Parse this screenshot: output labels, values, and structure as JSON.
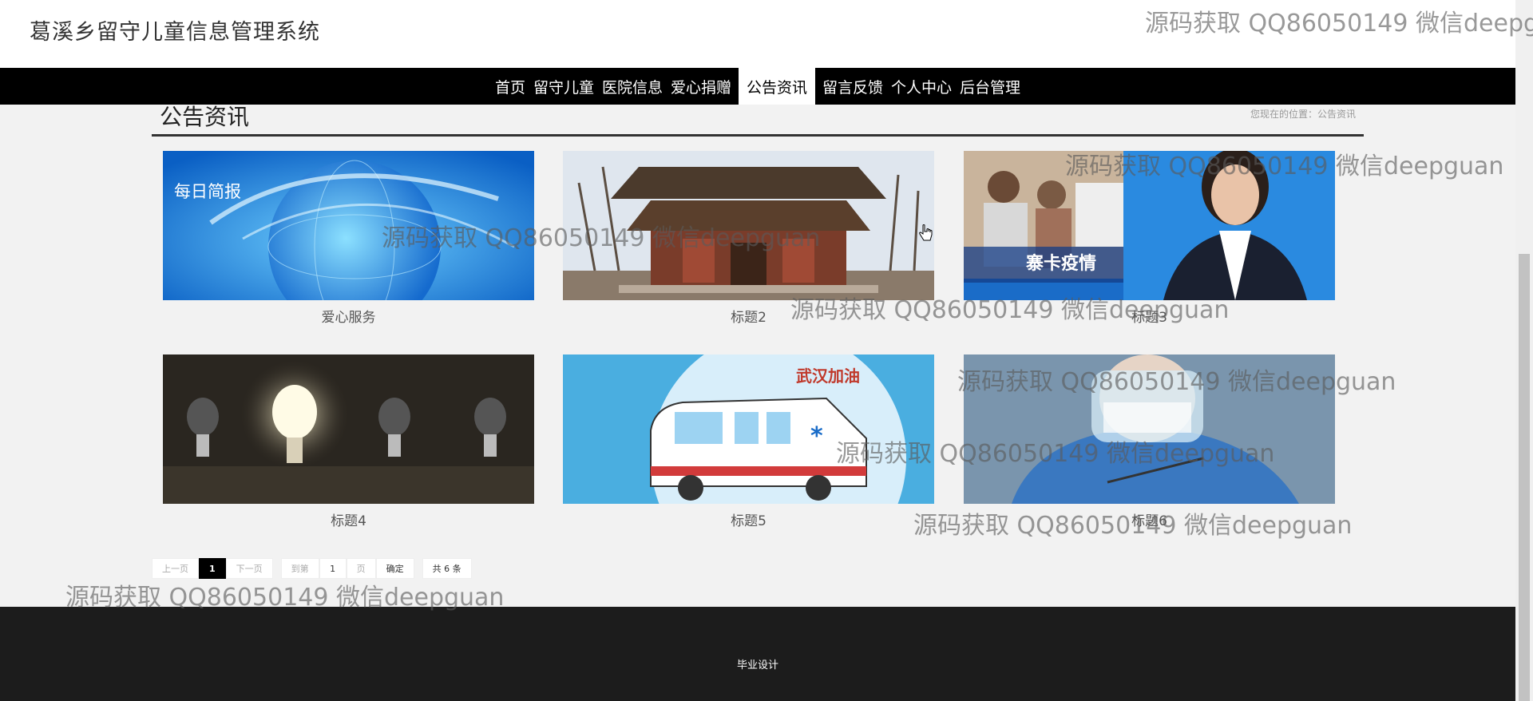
{
  "header": {
    "site_title": "葛溪乡留守儿童信息管理系统"
  },
  "nav": {
    "items": [
      {
        "label": "首页"
      },
      {
        "label": "留守儿童"
      },
      {
        "label": "医院信息"
      },
      {
        "label": "爱心捐赠"
      },
      {
        "label": "公告资讯",
        "active": true
      },
      {
        "label": "留言反馈"
      },
      {
        "label": "个人中心"
      },
      {
        "label": "后台管理"
      }
    ]
  },
  "page": {
    "section_title": "公告资讯",
    "breadcrumb": "您现在的位置：公告资讯"
  },
  "cards": [
    {
      "caption": "爱心服务",
      "image": "globe-banner-image",
      "overlay_text": "每日简报"
    },
    {
      "caption": "标题2",
      "image": "pagoda-image"
    },
    {
      "caption": "标题3",
      "image": "news-anchor-image",
      "overlay_text": "寨卡疫情"
    },
    {
      "caption": "标题4",
      "image": "light-bulbs-image"
    },
    {
      "caption": "标题5",
      "image": "ambulance-image",
      "overlay_text": "武汉加油"
    },
    {
      "caption": "标题6",
      "image": "medical-worker-image"
    }
  ],
  "pagination": {
    "prev": "上一页",
    "current": "1",
    "next": "下一页",
    "goto_prefix": "到第",
    "goto_value": "1",
    "goto_suffix": "页",
    "confirm": "确定",
    "total": "共 6 条"
  },
  "footer": {
    "text": "毕业设计"
  },
  "watermark": {
    "text": "源码获取 QQ86050149 微信deepguan"
  },
  "colors": {
    "nav_bg": "#000000",
    "footer_bg": "#1c1c1c",
    "accent": "#000000"
  }
}
